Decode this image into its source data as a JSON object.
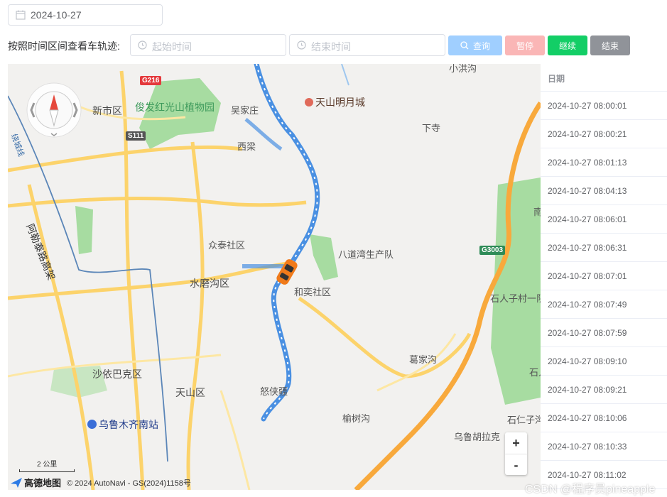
{
  "toolbar": {
    "date_value": "2024-10-27",
    "range_label": "按照时间区间查看车轨迹:",
    "start_placeholder": "起始时间",
    "end_placeholder": "结束时间",
    "query_label": "查询",
    "pause_label": "暂停",
    "continue_label": "继续",
    "end_label": "结束"
  },
  "map": {
    "labels": {
      "xinshi": "新市区",
      "junfa": "俊发红光山植物园",
      "wujiazhuang": "吴家庄",
      "tianshan_mingyue": "天山明月城",
      "xiaxi": "下寺",
      "xiliang": "西梁",
      "xiaohonggou": "小洪沟",
      "zhongtai": "众泰社区",
      "badaowan": "八道湾生产队",
      "shuimogou": "水磨沟区",
      "heyi": "和奕社区",
      "gejiagou": "葛家沟",
      "shiren": "石人子村一队",
      "shayibake": "沙依巴克区",
      "tianshan": "天山区",
      "nuxiazhong": "怒侠疆",
      "yushugou": "榆树沟",
      "station": "乌鲁木齐南站",
      "shirenzigou": "石仁子沟",
      "wulu_hula": "乌鲁胡拉克",
      "alatai": "阿勒泰路高架",
      "airport_line": "绕城线",
      "nanx": "南",
      "shiren2": "石人"
    },
    "shields": {
      "g216": "G216",
      "s111": "S111",
      "g3003": "G3003"
    },
    "scale_label": "2 公里",
    "brand": "高德地图",
    "copyright": "© 2024 AutoNavi - GS(2024)1158号",
    "zoom_in": "+",
    "zoom_out": "-",
    "colors": {
      "route": "#4a90e2",
      "highway": "#f8a93c",
      "main_road": "#fcd36b",
      "park": "#a7dca1"
    }
  },
  "timeline": {
    "header": "日期",
    "rows": [
      "2024-10-27 08:00:01",
      "2024-10-27 08:00:21",
      "2024-10-27 08:01:13",
      "2024-10-27 08:04:13",
      "2024-10-27 08:06:01",
      "2024-10-27 08:06:31",
      "2024-10-27 08:07:01",
      "2024-10-27 08:07:49",
      "2024-10-27 08:07:59",
      "2024-10-27 08:09:10",
      "2024-10-27 08:09:21",
      "2024-10-27 08:10:06",
      "2024-10-27 08:10:33",
      "2024-10-27 08:11:02"
    ]
  },
  "watermark": "CSDN @程序员pineapple"
}
